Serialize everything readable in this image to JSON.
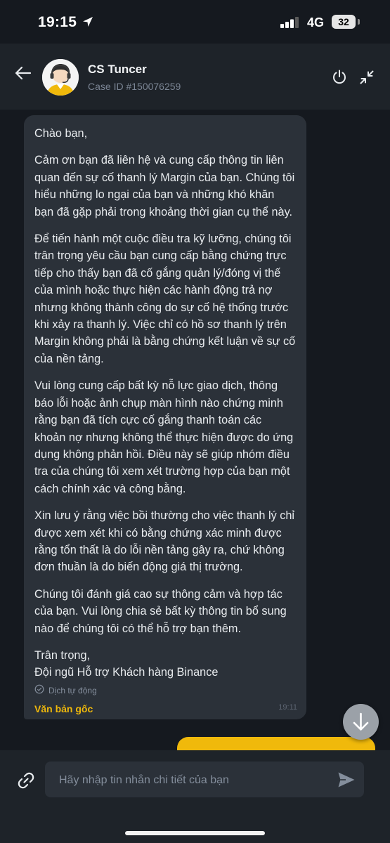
{
  "status_bar": {
    "time": "19:15",
    "network": "4G",
    "battery": "32"
  },
  "header": {
    "agent_name": "CS Tuncer",
    "case_id": "Case ID #150076259"
  },
  "message": {
    "greeting": "Chào bạn,",
    "paragraphs": [
      "Cảm ơn bạn đã liên hệ và cung cấp thông tin liên quan đến sự cố thanh lý Margin của bạn. Chúng tôi hiểu những lo ngại của bạn và những khó khăn bạn đã gặp phải trong khoảng thời gian cụ thể này.",
      "Để tiến hành một cuộc điều tra kỹ lưỡng, chúng tôi trân trọng yêu cầu bạn cung cấp bằng chứng trực tiếp cho thấy bạn đã cố gắng quản lý/đóng vị thế của mình hoặc thực hiện các hành động trả nợ nhưng không thành công do sự cố hệ thống trước khi xảy ra thanh lý. Việc chỉ có hồ sơ thanh lý trên Margin không phải là bằng chứng kết luận về sự cố của nền tảng.",
      "Vui lòng cung cấp bất kỳ nỗ lực giao dịch, thông báo lỗi hoặc ảnh chụp màn hình nào chứng minh rằng bạn đã tích cực cố gắng thanh toán các khoản nợ nhưng không thể thực hiện được do ứng dụng không phản hồi. Điều này sẽ giúp nhóm điều tra của chúng tôi xem xét trường hợp của bạn một cách chính xác và công bằng.",
      "Xin lưu ý rằng việc bồi thường cho việc thanh lý chỉ được xem xét khi có bằng chứng xác minh được rằng tổn thất là do lỗi nền tảng gây ra, chứ không đơn thuần là do biến động giá thị trường.",
      "Chúng tôi đánh giá cao sự thông cảm và hợp tác của bạn. Vui lòng chia sẻ bất kỳ thông tin bổ sung nào để chúng tôi có thể hỗ trợ bạn thêm."
    ],
    "sign_off_line1": "Trân trọng,",
    "sign_off_line2": "Đội ngũ Hỗ trợ Khách hàng Binance",
    "auto_translated": "Dịch tự động",
    "original_text_link": "Văn bản gốc",
    "time": "19:11"
  },
  "composer": {
    "placeholder": "Hãy nhập tin nhắn chi tiết của bạn"
  },
  "colors": {
    "accent": "#f0b90b",
    "background": "#15191f",
    "header": "#1e2329",
    "bubble": "#2b3139"
  },
  "icons": {
    "back": "arrow-left-icon",
    "power": "power-icon",
    "minimize": "minimize-arrows-icon",
    "scroll_down": "arrow-down-icon",
    "attach": "link-icon",
    "send": "send-icon",
    "auto_translate": "check-circle-icon"
  }
}
